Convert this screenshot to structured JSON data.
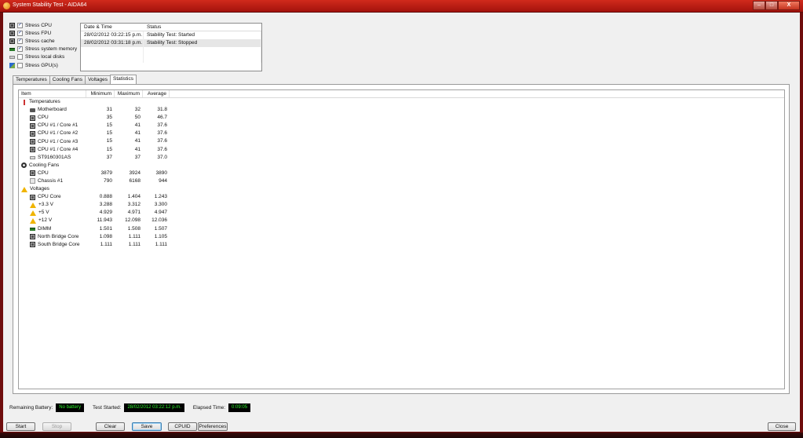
{
  "window": {
    "title": "System Stability Test - AIDA64",
    "controls": {
      "minimize": "–",
      "maximize": "□",
      "close": "X"
    }
  },
  "stress_options": [
    {
      "label": "Stress CPU",
      "checked": true,
      "icon": "cpu-chip-icon"
    },
    {
      "label": "Stress FPU",
      "checked": true,
      "icon": "fpu-chip-icon"
    },
    {
      "label": "Stress cache",
      "checked": true,
      "icon": "cache-chip-icon"
    },
    {
      "label": "Stress system memory",
      "checked": true,
      "icon": "memory-icon"
    },
    {
      "label": "Stress local disks",
      "checked": false,
      "icon": "disk-icon"
    },
    {
      "label": "Stress GPU(s)",
      "checked": false,
      "icon": "gpu-icon"
    }
  ],
  "log": {
    "headers": [
      "Date & Time",
      "Status"
    ],
    "rows": [
      {
        "datetime": "28/02/2012 03:22:15 p.m.",
        "status": "Stability Test: Started"
      },
      {
        "datetime": "28/02/2012 03:31:18 p.m.",
        "status": "Stability Test: Stopped"
      }
    ]
  },
  "tabs": [
    "Temperatures",
    "Cooling Fans",
    "Voltages",
    "Statistics"
  ],
  "active_tab": "Statistics",
  "stats": {
    "headers": {
      "item": "Item",
      "min": "Minimum",
      "max": "Maximum",
      "avg": "Average"
    },
    "rows": [
      {
        "item": "Temperatures",
        "group": true,
        "icon": "thermometer-icon"
      },
      {
        "item": "Motherboard",
        "min": "31",
        "max": "32",
        "avg": "31.8",
        "icon": "motherboard-icon"
      },
      {
        "item": "CPU",
        "min": "35",
        "max": "50",
        "avg": "46.7",
        "icon": "cpu-icon"
      },
      {
        "item": "CPU #1 / Core #1",
        "min": "15",
        "max": "41",
        "avg": "37.6",
        "icon": "cpu-icon"
      },
      {
        "item": "CPU #1 / Core #2",
        "min": "15",
        "max": "41",
        "avg": "37.6",
        "icon": "cpu-icon"
      },
      {
        "item": "CPU #1 / Core #3",
        "min": "15",
        "max": "41",
        "avg": "37.6",
        "icon": "cpu-icon"
      },
      {
        "item": "CPU #1 / Core #4",
        "min": "15",
        "max": "41",
        "avg": "37.6",
        "icon": "cpu-icon"
      },
      {
        "item": "ST9160301AS",
        "min": "37",
        "max": "37",
        "avg": "37.0",
        "icon": "disk-icon"
      },
      {
        "item": "Cooling Fans",
        "group": true,
        "icon": "fan-icon"
      },
      {
        "item": "CPU",
        "min": "3879",
        "max": "3924",
        "avg": "3890",
        "icon": "cpu-icon"
      },
      {
        "item": "Chassis #1",
        "min": "790",
        "max": "6168",
        "avg": "944",
        "icon": "chassis-icon"
      },
      {
        "item": "Voltages",
        "group": true,
        "icon": "warning-icon"
      },
      {
        "item": "CPU Core",
        "min": "0.888",
        "max": "1.404",
        "avg": "1.243",
        "icon": "cpu-icon"
      },
      {
        "item": "+3.3 V",
        "min": "3.288",
        "max": "3.312",
        "avg": "3.300",
        "icon": "warning-icon"
      },
      {
        "item": "+5 V",
        "min": "4.929",
        "max": "4.971",
        "avg": "4.947",
        "icon": "warning-icon"
      },
      {
        "item": "+12 V",
        "min": "11.943",
        "max": "12.098",
        "avg": "12.036",
        "icon": "warning-icon"
      },
      {
        "item": "DIMM",
        "min": "1.501",
        "max": "1.508",
        "avg": "1.507",
        "icon": "memory-icon"
      },
      {
        "item": "North Bridge Core",
        "min": "1.098",
        "max": "1.111",
        "avg": "1.105",
        "icon": "chip-icon"
      },
      {
        "item": "South Bridge Core",
        "min": "1.111",
        "max": "1.111",
        "avg": "1.111",
        "icon": "chip-icon"
      }
    ]
  },
  "status_bar": {
    "remaining_battery_label": "Remaining Battery:",
    "remaining_battery_value": "No battery",
    "test_started_label": "Test Started:",
    "test_started_value": "28/02/2012 03:22:12 p.m.",
    "elapsed_label": "Elapsed Time:",
    "elapsed_value": "0:09:05"
  },
  "buttons": {
    "start": "Start",
    "stop": "Stop",
    "clear": "Clear",
    "save": "Save",
    "cpuid": "CPUID",
    "preferences": "Preferences",
    "close": "Close"
  }
}
